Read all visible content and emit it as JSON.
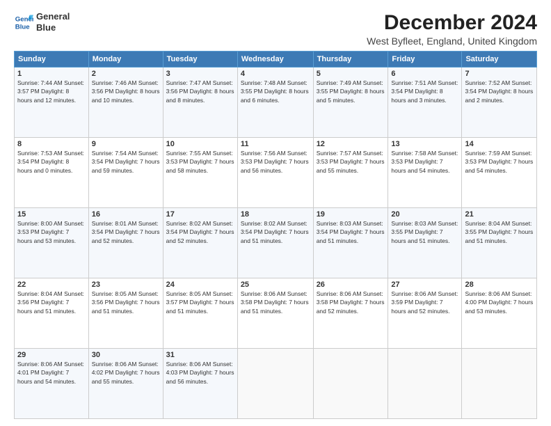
{
  "header": {
    "logo_line1": "General",
    "logo_line2": "Blue",
    "title": "December 2024",
    "subtitle": "West Byfleet, England, United Kingdom"
  },
  "calendar": {
    "headers": [
      "Sunday",
      "Monday",
      "Tuesday",
      "Wednesday",
      "Thursday",
      "Friday",
      "Saturday"
    ],
    "rows": [
      [
        {
          "day": "1",
          "info": "Sunrise: 7:44 AM\nSunset: 3:57 PM\nDaylight: 8 hours\nand 12 minutes."
        },
        {
          "day": "2",
          "info": "Sunrise: 7:46 AM\nSunset: 3:56 PM\nDaylight: 8 hours\nand 10 minutes."
        },
        {
          "day": "3",
          "info": "Sunrise: 7:47 AM\nSunset: 3:56 PM\nDaylight: 8 hours\nand 8 minutes."
        },
        {
          "day": "4",
          "info": "Sunrise: 7:48 AM\nSunset: 3:55 PM\nDaylight: 8 hours\nand 6 minutes."
        },
        {
          "day": "5",
          "info": "Sunrise: 7:49 AM\nSunset: 3:55 PM\nDaylight: 8 hours\nand 5 minutes."
        },
        {
          "day": "6",
          "info": "Sunrise: 7:51 AM\nSunset: 3:54 PM\nDaylight: 8 hours\nand 3 minutes."
        },
        {
          "day": "7",
          "info": "Sunrise: 7:52 AM\nSunset: 3:54 PM\nDaylight: 8 hours\nand 2 minutes."
        }
      ],
      [
        {
          "day": "8",
          "info": "Sunrise: 7:53 AM\nSunset: 3:54 PM\nDaylight: 8 hours\nand 0 minutes."
        },
        {
          "day": "9",
          "info": "Sunrise: 7:54 AM\nSunset: 3:54 PM\nDaylight: 7 hours\nand 59 minutes."
        },
        {
          "day": "10",
          "info": "Sunrise: 7:55 AM\nSunset: 3:53 PM\nDaylight: 7 hours\nand 58 minutes."
        },
        {
          "day": "11",
          "info": "Sunrise: 7:56 AM\nSunset: 3:53 PM\nDaylight: 7 hours\nand 56 minutes."
        },
        {
          "day": "12",
          "info": "Sunrise: 7:57 AM\nSunset: 3:53 PM\nDaylight: 7 hours\nand 55 minutes."
        },
        {
          "day": "13",
          "info": "Sunrise: 7:58 AM\nSunset: 3:53 PM\nDaylight: 7 hours\nand 54 minutes."
        },
        {
          "day": "14",
          "info": "Sunrise: 7:59 AM\nSunset: 3:53 PM\nDaylight: 7 hours\nand 54 minutes."
        }
      ],
      [
        {
          "day": "15",
          "info": "Sunrise: 8:00 AM\nSunset: 3:53 PM\nDaylight: 7 hours\nand 53 minutes."
        },
        {
          "day": "16",
          "info": "Sunrise: 8:01 AM\nSunset: 3:54 PM\nDaylight: 7 hours\nand 52 minutes."
        },
        {
          "day": "17",
          "info": "Sunrise: 8:02 AM\nSunset: 3:54 PM\nDaylight: 7 hours\nand 52 minutes."
        },
        {
          "day": "18",
          "info": "Sunrise: 8:02 AM\nSunset: 3:54 PM\nDaylight: 7 hours\nand 51 minutes."
        },
        {
          "day": "19",
          "info": "Sunrise: 8:03 AM\nSunset: 3:54 PM\nDaylight: 7 hours\nand 51 minutes."
        },
        {
          "day": "20",
          "info": "Sunrise: 8:03 AM\nSunset: 3:55 PM\nDaylight: 7 hours\nand 51 minutes."
        },
        {
          "day": "21",
          "info": "Sunrise: 8:04 AM\nSunset: 3:55 PM\nDaylight: 7 hours\nand 51 minutes."
        }
      ],
      [
        {
          "day": "22",
          "info": "Sunrise: 8:04 AM\nSunset: 3:56 PM\nDaylight: 7 hours\nand 51 minutes."
        },
        {
          "day": "23",
          "info": "Sunrise: 8:05 AM\nSunset: 3:56 PM\nDaylight: 7 hours\nand 51 minutes."
        },
        {
          "day": "24",
          "info": "Sunrise: 8:05 AM\nSunset: 3:57 PM\nDaylight: 7 hours\nand 51 minutes."
        },
        {
          "day": "25",
          "info": "Sunrise: 8:06 AM\nSunset: 3:58 PM\nDaylight: 7 hours\nand 51 minutes."
        },
        {
          "day": "26",
          "info": "Sunrise: 8:06 AM\nSunset: 3:58 PM\nDaylight: 7 hours\nand 52 minutes."
        },
        {
          "day": "27",
          "info": "Sunrise: 8:06 AM\nSunset: 3:59 PM\nDaylight: 7 hours\nand 52 minutes."
        },
        {
          "day": "28",
          "info": "Sunrise: 8:06 AM\nSunset: 4:00 PM\nDaylight: 7 hours\nand 53 minutes."
        }
      ],
      [
        {
          "day": "29",
          "info": "Sunrise: 8:06 AM\nSunset: 4:01 PM\nDaylight: 7 hours\nand 54 minutes."
        },
        {
          "day": "30",
          "info": "Sunrise: 8:06 AM\nSunset: 4:02 PM\nDaylight: 7 hours\nand 55 minutes."
        },
        {
          "day": "31",
          "info": "Sunrise: 8:06 AM\nSunset: 4:03 PM\nDaylight: 7 hours\nand 56 minutes."
        },
        null,
        null,
        null,
        null
      ]
    ]
  }
}
